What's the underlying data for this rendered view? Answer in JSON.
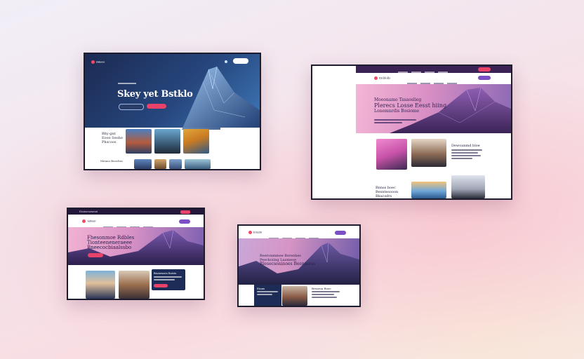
{
  "colors": {
    "navy": "#1d2b57",
    "blue_hero": "#2c4f86",
    "purple_nav": "#3b2254",
    "pink_hero": "#e79ac7",
    "accent_red": "#e8426a",
    "accent_purple": "#7c4fc4"
  },
  "mock1": {
    "brand": "ɪᴍʙᴀᴀᴀ",
    "nav_cta": "▭▭▭▭",
    "hero_title": "Skey yet Bstklo",
    "left_text": "Bhy·gnt\nEooo Seoho\nPhscoos",
    "bottom_text": "Meuoo Boocboc"
  },
  "mock2": {
    "brand": "Eiddolls",
    "hero_title_1": "Moeonamo Tasaoslieg",
    "hero_title_2": "Plerecs Losse Eesst hiing",
    "hero_title_3": "Lonemnrdis Bosiome",
    "profile_heading": "Dewoanmd bloe",
    "left_text": "Bnnss boec\nBesntesooon\nBkacsdrs"
  },
  "mock3": {
    "top_label": "Elodomorsmat",
    "brand": "ꝛulbsel",
    "hero_title_1": "Fhesonmoe Rdbles",
    "hero_title_2": "Tionteeneneraeee",
    "hero_title_3": "Bneecocbiaalssbo",
    "card_title": "Bsvansoeo Bolnto"
  },
  "mock4": {
    "brand": "Eriscbl",
    "hero_title_1": "Reeronmmee Bsrenhes",
    "hero_title_2": "Peeckoiing Laameoe",
    "hero_title_3": "Rlesecsoninoes Beenmess",
    "card_title": "Ekoas",
    "card_title_2": "Brearoa Boee"
  },
  "icons": [
    "logo-icon",
    "mountain-art",
    "portrait-photo",
    "sunset-photo"
  ]
}
